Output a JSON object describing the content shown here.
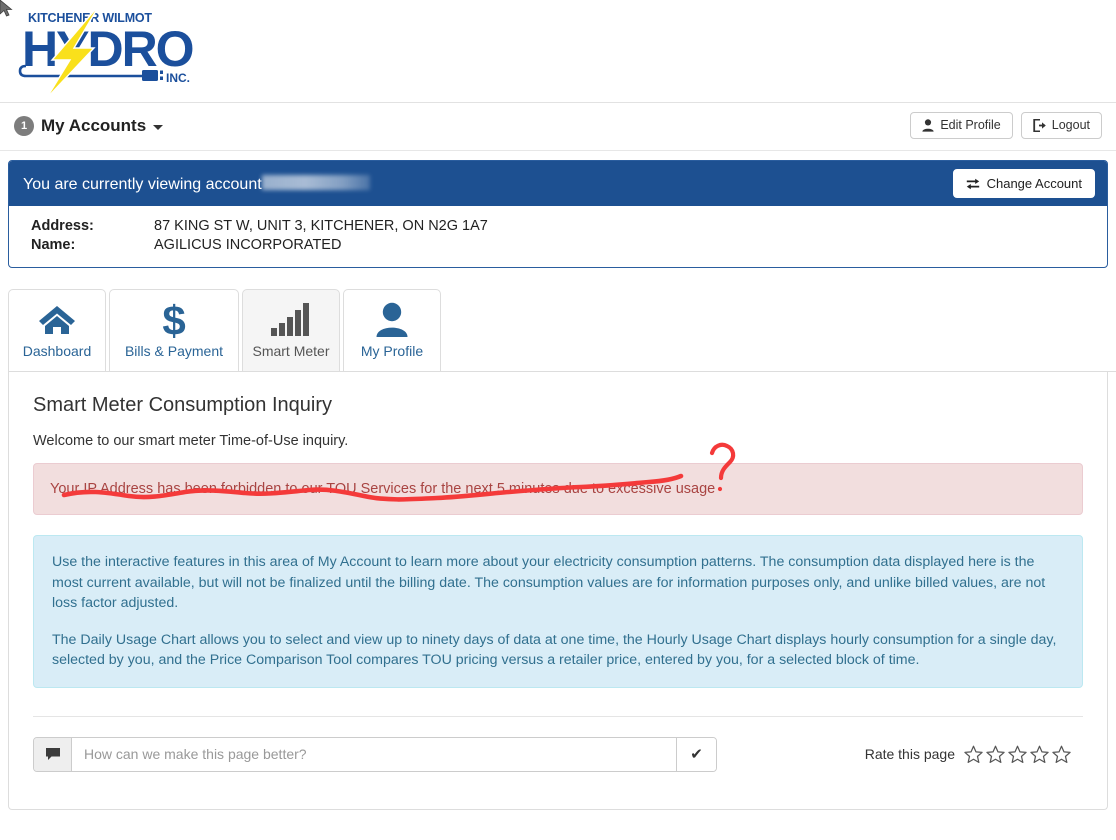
{
  "logo": {
    "top_text": "KITCHENER WILMOT",
    "main_text": "HYDRO",
    "suffix_text": "INC.",
    "brand_blue": "#1b4f9c",
    "brand_yellow": "#f9e01b"
  },
  "toolbar": {
    "accounts_badge": "1",
    "accounts_label": "My Accounts",
    "edit_profile_label": "Edit Profile",
    "logout_label": "Logout"
  },
  "account_panel": {
    "banner_text": "You are currently viewing account",
    "banner_color": "#1d5091",
    "change_account_label": "Change Account",
    "address_label": "Address:",
    "address_value": "87 KING ST W, UNIT 3, KITCHENER, ON  N2G 1A7",
    "name_label": "Name:",
    "name_value": "AGILICUS INCORPORATED"
  },
  "tabs": [
    {
      "label": "Dashboard",
      "icon": "home-icon",
      "active": false
    },
    {
      "label": "Bills & Payment",
      "icon": "dollar-icon",
      "active": false
    },
    {
      "label": "Smart Meter",
      "icon": "signal-bars-icon",
      "active": true
    },
    {
      "label": "My Profile",
      "icon": "person-icon",
      "active": false
    }
  ],
  "main": {
    "title": "Smart Meter Consumption Inquiry",
    "welcome": "Welcome to our smart meter Time-of-Use inquiry.",
    "error_message": "Your IP Address has been forbidden to our TOU Services for the next 5 minutes due to excessive usage",
    "error_bg": "#f2dede",
    "error_text_color": "#a94442",
    "info_bg": "#d9edf7",
    "info_text_color": "#31708f",
    "info_paragraph_1": "Use the interactive features in this area of My Account to learn more about your electricity consumption patterns. The consumption data displayed here is the most current available, but will not be finalized until the billing date. The consumption values are for information purposes only, and unlike billed values, are not loss factor adjusted.",
    "info_paragraph_2": "The Daily Usage Chart allows you to select and view up to ninety days of data at one time, the Hourly Usage Chart displays hourly consumption for a single day, selected by you, and the Price Comparison Tool compares TOU pricing versus a retailer price, entered by you, for a selected block of time."
  },
  "annotation": {
    "color": "#f43a3a",
    "question_mark": "?"
  },
  "feedback": {
    "placeholder": "How can we make this page better?",
    "value": "",
    "submit_glyph": "✔",
    "rate_label": "Rate this page",
    "stars": [
      "☆",
      "☆",
      "☆",
      "☆",
      "☆"
    ]
  }
}
